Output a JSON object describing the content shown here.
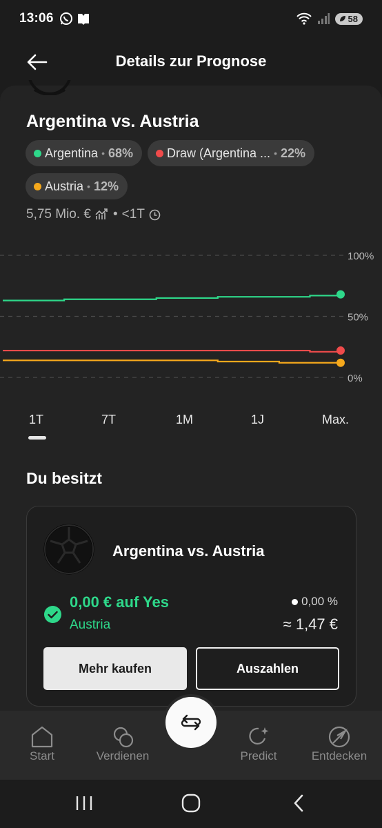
{
  "status_bar": {
    "time": "13:06",
    "battery": "58",
    "signal_label": "5"
  },
  "header": {
    "title": "Details zur Prognose"
  },
  "event": {
    "title": "Argentina vs. Austria"
  },
  "outcomes": [
    {
      "name": "Argentina",
      "pct": "68%",
      "color": "#2ed88a"
    },
    {
      "name": "Draw (Argentina ...",
      "pct": "22%",
      "color": "#f04b4b"
    },
    {
      "name": "Austria",
      "pct": "12%",
      "color": "#f5a81c"
    }
  ],
  "pill_separator": "•",
  "meta": {
    "volume": "5,75 Mio. €",
    "separator": "•",
    "time_left": "<1T"
  },
  "chart_data": {
    "type": "line",
    "y_ticks": [
      "100%",
      "50%",
      "0%"
    ],
    "ylim": [
      0,
      100
    ],
    "grid": true,
    "series": [
      {
        "name": "Argentina",
        "color": "#2ed88a",
        "values": [
          63,
          63,
          64,
          64,
          64,
          65,
          65,
          66,
          66,
          66,
          67,
          68
        ]
      },
      {
        "name": "Draw (Argentina ...",
        "color": "#f04b4b",
        "values": [
          22,
          22,
          22,
          22,
          22,
          22,
          22,
          22,
          22,
          22,
          21,
          22
        ]
      },
      {
        "name": "Austria",
        "color": "#f5a81c",
        "values": [
          14,
          14,
          14,
          14,
          14,
          14,
          14,
          13,
          13,
          12,
          12,
          12
        ]
      }
    ]
  },
  "ranges": [
    "1T",
    "7T",
    "1M",
    "1J",
    "Max."
  ],
  "selected_range": "1T",
  "holdings": {
    "section_title": "Du besitzt",
    "title": "Argentina vs. Austria",
    "amount": "0,00 € auf Yes",
    "outcome": "Austria",
    "change": "0,00 %",
    "value": "≈ 1,47 €",
    "buy_label": "Mehr kaufen",
    "payout_label": "Auszahlen"
  },
  "nav": {
    "start": "Start",
    "earn": "Verdienen",
    "predict": "Predict",
    "discover": "Entdecken"
  },
  "colors": {
    "accent": "#2ed88a",
    "red": "#f04b4b",
    "orange": "#f5a81c"
  }
}
